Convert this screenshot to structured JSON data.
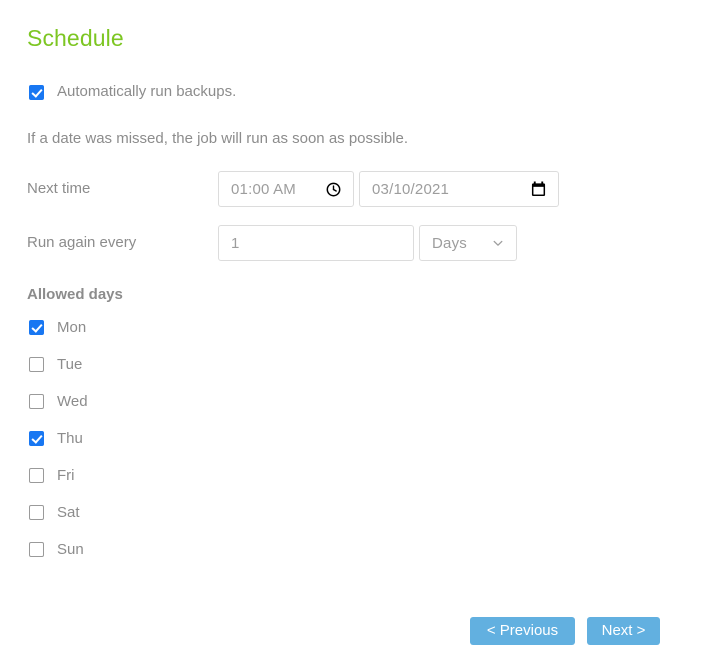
{
  "page": {
    "title": "Schedule",
    "title_color": "#7dc623",
    "background": "#ffffff"
  },
  "auto_run": {
    "label": "Automatically run backups.",
    "checked": true
  },
  "hint": {
    "text": "If a date was missed, the job will run as soon as possible."
  },
  "next_time": {
    "label": "Next time",
    "time_value": "01:00 AM",
    "time_icon": "clock-icon",
    "date_value": "03/10/2021",
    "date_icon": "calendar-icon"
  },
  "run_again": {
    "label": "Run again every",
    "interval_value": "1",
    "unit_value": "Days",
    "unit_icon": "chevron-down-icon",
    "unit_options": [
      "Days"
    ]
  },
  "allowed_days": {
    "heading": "Allowed days",
    "days": [
      {
        "label": "Mon",
        "checked": true
      },
      {
        "label": "Tue",
        "checked": false
      },
      {
        "label": "Wed",
        "checked": false
      },
      {
        "label": "Thu",
        "checked": true
      },
      {
        "label": "Fri",
        "checked": false
      },
      {
        "label": "Sat",
        "checked": false
      },
      {
        "label": "Sun",
        "checked": false
      }
    ]
  },
  "footer": {
    "previous_label": "< Previous",
    "next_label": "Next >",
    "button_color": "#62b0e0"
  },
  "colors": {
    "checkbox_checked": "#1877f2",
    "checkbox_border": "#9a9a9a",
    "text": "#8c8c8c",
    "field_border": "#dcdcdc",
    "field_text": "#9d9d9d"
  }
}
